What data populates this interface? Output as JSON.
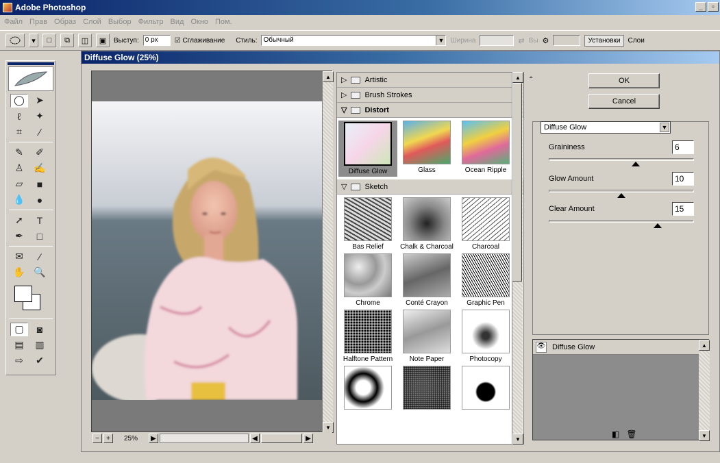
{
  "app": {
    "title": "Adobe Photoshop"
  },
  "menu": [
    "Файл",
    "Прав",
    "Образ",
    "Слой",
    "Выбор",
    "Фильтр",
    "Вид",
    "Окно",
    "Пом."
  ],
  "options": {
    "feather_label": "Выступ:",
    "feather_value": "0 px",
    "antialias_label": "Сглаживание",
    "style_label": "Стиль:",
    "style_value": "Обычный",
    "width_label": "Ширина",
    "height_label": "Вы",
    "tab_settings": "Установки",
    "tab_layers": "Слои"
  },
  "dialog": {
    "title": "Diffuse Glow (25%)",
    "zoom": "25%",
    "ok": "OK",
    "cancel": "Cancel",
    "selected_filter": "Diffuse Glow"
  },
  "categories": {
    "artistic": "Artistic",
    "brush": "Brush Strokes",
    "distort": "Distort",
    "sketch": "Sketch"
  },
  "distort_filters": [
    "Diffuse Glow",
    "Glass",
    "Ocean Ripple"
  ],
  "sketch_filters": [
    "Bas Relief",
    "Chalk & Charcoal",
    "Charcoal",
    "Chrome",
    "Conté Crayon",
    "Graphic Pen",
    "Halftone Pattern",
    "Note Paper",
    "Photocopy"
  ],
  "params": {
    "graininess": {
      "label": "Graininess",
      "value": "6",
      "fraction": 0.6
    },
    "glow": {
      "label": "Glow Amount",
      "value": "10",
      "fraction": 0.5
    },
    "clear": {
      "label": "Clear Amount",
      "value": "15",
      "fraction": 0.75
    }
  },
  "layer": {
    "name": "Diffuse Glow"
  }
}
